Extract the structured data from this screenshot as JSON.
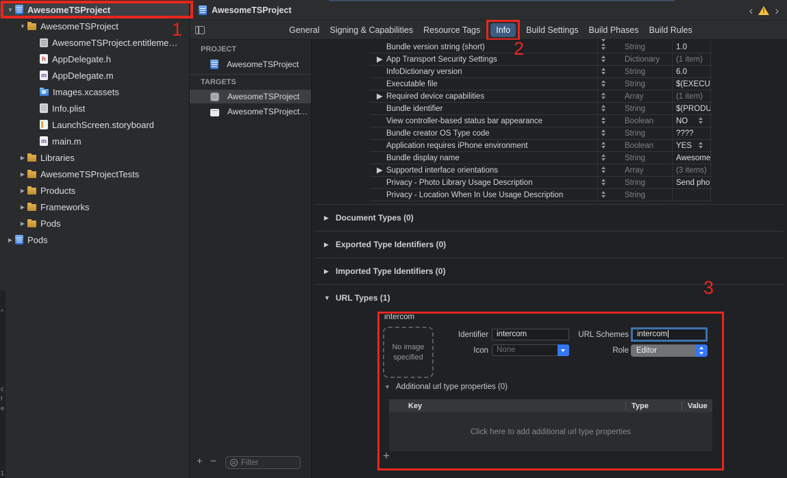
{
  "jumpbar": {
    "title": "AwesomeTSProject"
  },
  "tabbar": {
    "tabs": [
      {
        "label": "General"
      },
      {
        "label": "Signing & Capabilities"
      },
      {
        "label": "Resource Tags"
      },
      {
        "label": "Info",
        "selected": true,
        "annotated": true
      },
      {
        "label": "Build Settings"
      },
      {
        "label": "Build Phases"
      },
      {
        "label": "Build Rules"
      }
    ]
  },
  "navigator": {
    "items": [
      {
        "label": "AwesomeTSProject",
        "icon": "project-file-icon",
        "depth": 0,
        "disclosure": "open",
        "selected": true
      },
      {
        "label": "AwesomeTSProject",
        "icon": "folder-icon",
        "depth": 1,
        "disclosure": "open"
      },
      {
        "label": "AwesomeTSProject.entitleme…",
        "icon": "entitlements-icon",
        "depth": 2
      },
      {
        "label": "AppDelegate.h",
        "icon": "header-file-icon",
        "depth": 2
      },
      {
        "label": "AppDelegate.m",
        "icon": "implementation-file-icon",
        "depth": 2
      },
      {
        "label": "Images.xcassets",
        "icon": "asset-catalog-icon",
        "depth": 2
      },
      {
        "label": "Info.plist",
        "icon": "plist-icon",
        "depth": 2
      },
      {
        "label": "LaunchScreen.storyboard",
        "icon": "storyboard-icon",
        "depth": 2
      },
      {
        "label": "main.m",
        "icon": "implementation-file-icon",
        "depth": 2
      },
      {
        "label": "Libraries",
        "icon": "folder-icon",
        "depth": 1,
        "disclosure": "closed"
      },
      {
        "label": "AwesomeTSProjectTests",
        "icon": "folder-icon",
        "depth": 1,
        "disclosure": "closed"
      },
      {
        "label": "Products",
        "icon": "folder-icon",
        "depth": 1,
        "disclosure": "closed"
      },
      {
        "label": "Frameworks",
        "icon": "folder-icon",
        "depth": 1,
        "disclosure": "closed"
      },
      {
        "label": "Pods",
        "icon": "folder-icon",
        "depth": 1,
        "disclosure": "closed"
      },
      {
        "label": "Pods",
        "icon": "project-file-icon",
        "depth": 0,
        "disclosure": "closed"
      }
    ]
  },
  "project_panel": {
    "project_header": "PROJECT",
    "project_name": "AwesomeTSProject",
    "targets_header": "TARGETS",
    "targets": [
      {
        "name": "AwesomeTSProject",
        "icon": "app-target-icon",
        "selected": true
      },
      {
        "name": "AwesomeTSProject…",
        "icon": "tests-target-icon"
      }
    ],
    "add_label": "+",
    "remove_label": "−",
    "filter_placeholder": "Filter"
  },
  "editor": {
    "plist_rows": [
      {
        "key": "Bundle version string (short)",
        "type": "String",
        "value": "1.0"
      },
      {
        "key": "App Transport Security Settings",
        "disclosure": "closed",
        "type": "Dictionary",
        "value": "(1 item)",
        "value_muted": true
      },
      {
        "key": "InfoDictionary version",
        "type": "String",
        "value": "6.0"
      },
      {
        "key": "Executable file",
        "type": "String",
        "value": "$(EXECU"
      },
      {
        "key": "Required device capabilities",
        "disclosure": "closed",
        "type": "Array",
        "value": "(1 item)",
        "value_muted": true
      },
      {
        "key": "Bundle identifier",
        "type": "String",
        "value": "$(PRODU"
      },
      {
        "key": "View controller-based status bar appearance",
        "type": "Boolean",
        "value": "NO",
        "value_stepper": true
      },
      {
        "key": "Bundle creator OS Type code",
        "type": "String",
        "value": "????"
      },
      {
        "key": "Application requires iPhone environment",
        "type": "Boolean",
        "value": "YES",
        "value_stepper": true
      },
      {
        "key": "Bundle display name",
        "type": "String",
        "value": "Awesome"
      },
      {
        "key": "Supported interface orientations",
        "disclosure": "closed",
        "type": "Array",
        "value": "(3 items)",
        "value_muted": true
      },
      {
        "key": "Privacy - Photo Library Usage Description",
        "type": "String",
        "value": "Send pho"
      },
      {
        "key": "Privacy - Location When In Use Usage Description",
        "type": "String",
        "value": ""
      }
    ],
    "sections": [
      {
        "label": "Document Types (0)",
        "disclosure": "closed"
      },
      {
        "label": "Exported Type Identifiers (0)",
        "disclosure": "closed"
      },
      {
        "label": "Imported Type Identifiers (0)",
        "disclosure": "closed"
      },
      {
        "label": "URL Types (1)",
        "disclosure": "open"
      }
    ],
    "url_type": {
      "name": "intercom",
      "no_image_text": "No image specified",
      "identifier_label": "Identifier",
      "identifier_value": "intercom",
      "icon_label": "Icon",
      "icon_value": "None",
      "url_schemes_label": "URL Schemes",
      "url_schemes_value": "intercom",
      "role_label": "Role",
      "role_value": "Editor",
      "additional_label": "Additional url type properties (0)",
      "table": {
        "columns": [
          "Key",
          "Type",
          "Value"
        ],
        "empty_text": "Click here to add additional url type properties"
      },
      "add_label": "+"
    }
  },
  "annotations": {
    "one": "1",
    "two": "2",
    "three": "3"
  },
  "edge_artifacts": [
    "^",
    "c",
    "f",
    "e",
    "1"
  ],
  "colors": {
    "annotation_red": "#e8261d",
    "accent_blue": "#3577f3",
    "selected_tab": "#3e5a7d",
    "folder_yellow": "#d9a63f",
    "warning_yellow": "#f3c040"
  }
}
